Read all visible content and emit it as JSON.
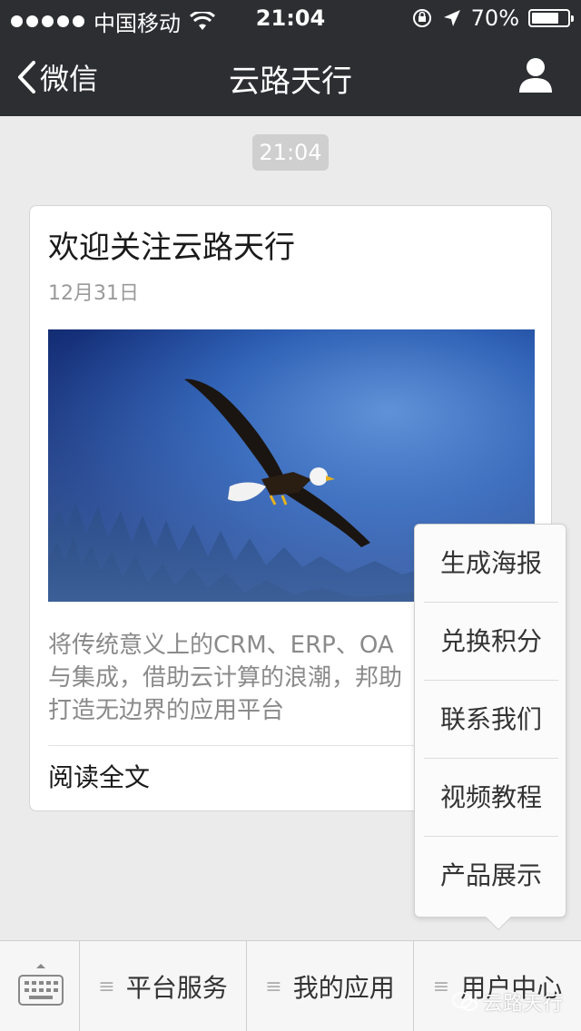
{
  "status_bar": {
    "carrier": "中国移动",
    "time": "21:04",
    "battery": "70%",
    "battery_level": 0.7
  },
  "nav": {
    "back_label": "微信",
    "title": "云路天行",
    "icons": [
      "chevron-left-icon",
      "user-icon"
    ]
  },
  "chat": {
    "timestamp": "21:04"
  },
  "article": {
    "title": "欢迎关注云路天行",
    "date": "12月31日",
    "image": "eagle-photo",
    "summary_line1": "将传统意义上的CRM、ERP、OA",
    "summary_line2": "与集成，借助云计算的浪潮，邦助",
    "summary_line3": "打造无边界的应用平台",
    "read_more": "阅读全文"
  },
  "popup_menu": {
    "items": [
      "生成海报",
      "兑换积分",
      "联系我们",
      "视频教程",
      "产品展示"
    ]
  },
  "bottom_menu": {
    "keyboard_icon": "keyboard-icon",
    "buttons": [
      "平台服务",
      "我的应用",
      "用户中心"
    ]
  },
  "watermark": {
    "text": "云路天行"
  }
}
